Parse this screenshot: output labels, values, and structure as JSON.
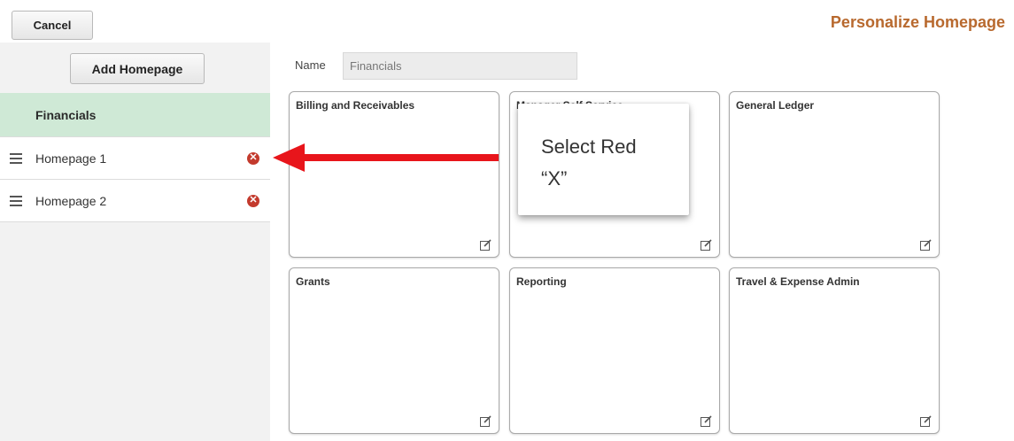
{
  "header": {
    "cancel_label": "Cancel",
    "title": "Personalize Homepage"
  },
  "sidebar": {
    "add_button_label": "Add Homepage",
    "selected": {
      "label": "Financials"
    },
    "items": [
      {
        "label": "Homepage 1",
        "drag_icon": "drag-handle-icon",
        "remove_icon": "remove-circle-icon"
      },
      {
        "label": "Homepage 2",
        "drag_icon": "drag-handle-icon",
        "remove_icon": "remove-circle-icon"
      }
    ]
  },
  "main": {
    "name_label": "Name",
    "name_value": "Financials",
    "tiles": [
      {
        "title": "Billing and Receivables"
      },
      {
        "title": "Manager Self Service"
      },
      {
        "title": "General Ledger"
      },
      {
        "title": "Grants"
      },
      {
        "title": "Reporting"
      },
      {
        "title": "Travel & Expense Admin"
      }
    ]
  },
  "callout": {
    "line1": "Select Red",
    "line2": "“X”"
  },
  "colors": {
    "title": "#b8692e",
    "selected_bg": "#cfe9d6",
    "remove": "#c33a2d",
    "arrow": "#e8151b"
  }
}
